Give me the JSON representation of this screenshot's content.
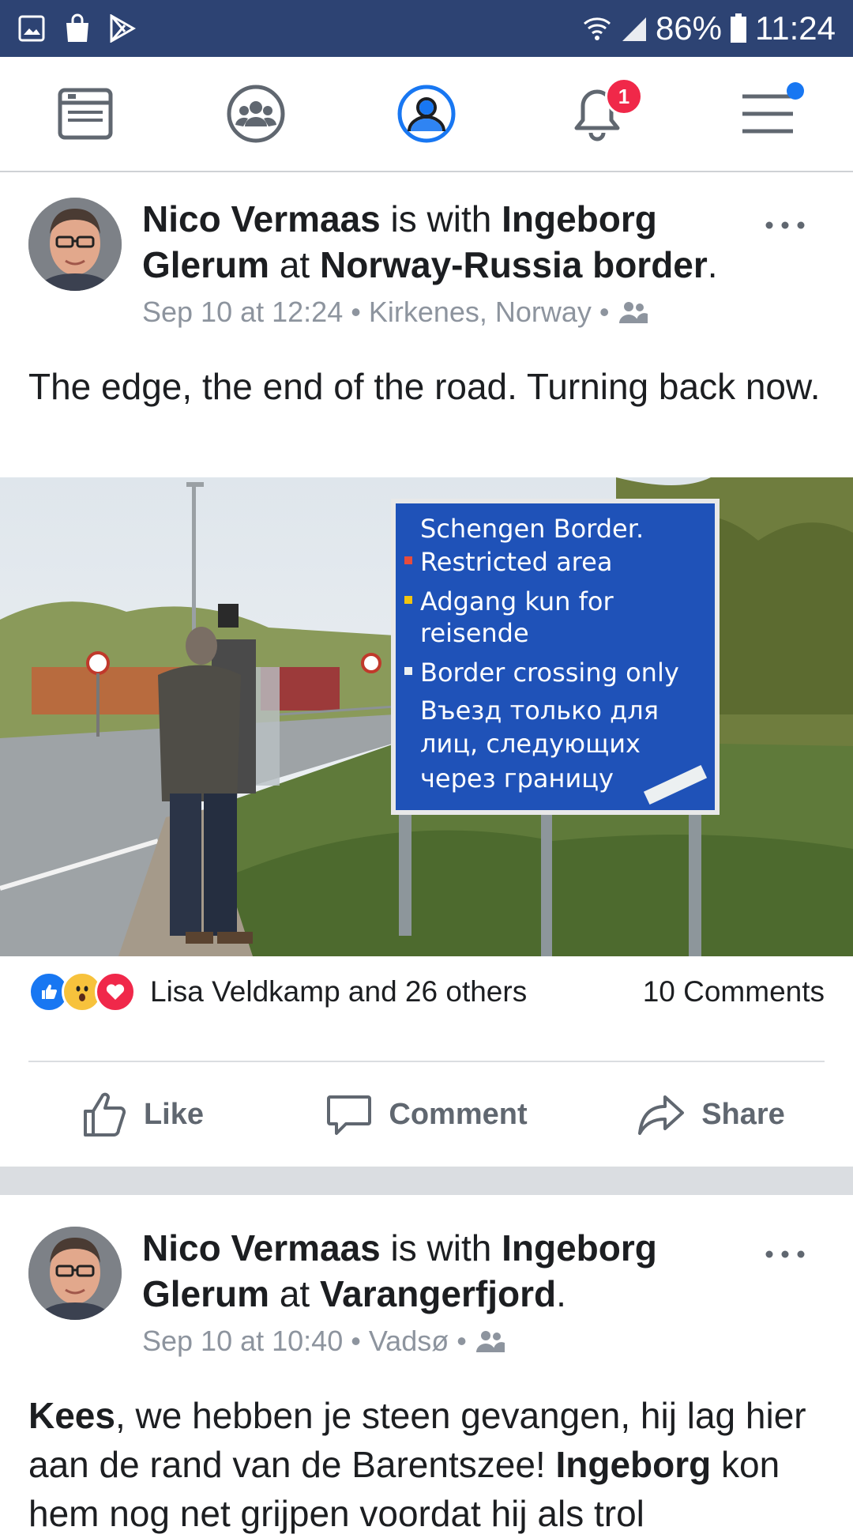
{
  "status_bar": {
    "icons_left": [
      "gallery-icon",
      "shopping-bag-icon",
      "play-store-icon"
    ],
    "battery": "86%",
    "time": "11:24"
  },
  "nav": {
    "items": [
      "news-feed-icon",
      "groups-icon",
      "profile-icon",
      "notifications-icon",
      "menu-icon"
    ],
    "notifications_badge": "1",
    "active_color": "#1877f2"
  },
  "posts": [
    {
      "author": "Nico Vermaas",
      "with_text": " is with ",
      "tagged": "Ingeborg Glerum",
      "at_text": " at ",
      "place": "Norway-Russia border",
      "period": ".",
      "time": "Sep 10 at 12:24",
      "location": "Kirkenes, Norway",
      "audience_icon": "friends-icon",
      "text": "The edge, the end of the road. Turning back now.",
      "photo": {
        "sign_lines": [
          "Schengen Border.",
          "Restricted area",
          "Adgang kun for",
          "reisende",
          "Border crossing only",
          "Въезд только для",
          "лиц, следующих",
          "через границу"
        ]
      },
      "reactions_text": "Lisa Veldkamp and 26 others",
      "comments_text": "10 Comments",
      "actions": {
        "like": "Like",
        "comment": "Comment",
        "share": "Share"
      }
    },
    {
      "author": "Nico Vermaas",
      "with_text": " is with ",
      "tagged": "Ingeborg Glerum",
      "at_text": " at ",
      "place": "Varangerfjord",
      "period": ".",
      "time": "Sep 10 at 10:40",
      "location": "Vadsø",
      "audience_icon": "friends-icon",
      "text_bold_1": "Kees",
      "text_1": ", we hebben je steen gevangen, hij lag hier aan de rand van de Barentszee! ",
      "text_bold_2": "Ingeborg",
      "text_2": " kon hem nog net grijpen voordat hij als trol"
    }
  ]
}
